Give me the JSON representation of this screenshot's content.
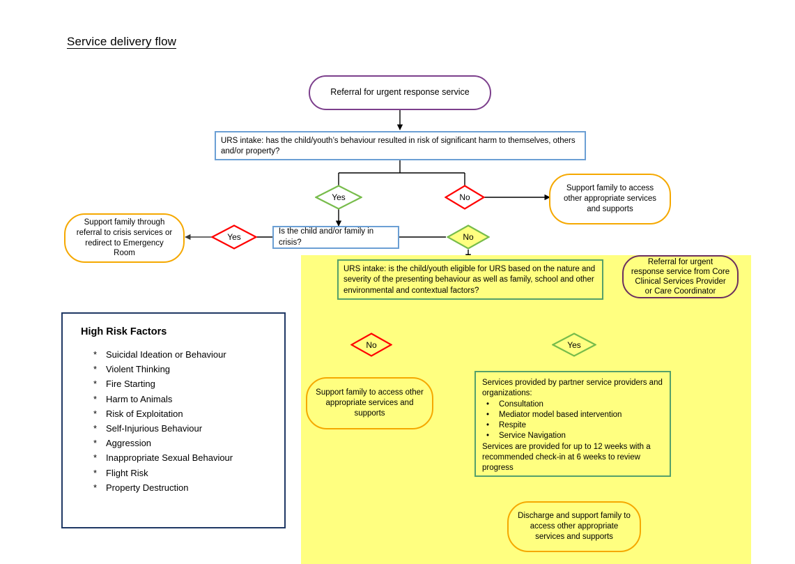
{
  "title": "Service delivery flow",
  "colors": {
    "highlight_region": "#ffff80",
    "terminator_border": "#7c3f8c",
    "orange_border": "#f5a800",
    "blue_border": "#6b9fd4",
    "green_border": "#55a06a",
    "yes_green": "#77bc4b",
    "no_red": "#ff0000",
    "legend_border": "#1f3864",
    "connector": "#000000"
  },
  "nodes": {
    "start": {
      "text": "Referral for urgent response service"
    },
    "intake_harm": {
      "text": "URS intake: has the child/youth’s behaviour resulted in risk of significant harm to themselves, others and/or property?"
    },
    "d1_yes": {
      "label": "Yes"
    },
    "d1_no": {
      "label": "No"
    },
    "support_other_1": {
      "text": "Support family to access other appropriate services and supports"
    },
    "crisis_question": {
      "text": "Is the child and/or family in crisis?"
    },
    "d2_yes": {
      "label": "Yes"
    },
    "d2_no": {
      "label": "No"
    },
    "crisis_referral": {
      "text": "Support family through referral to crisis services or redirect to Emergency Room"
    },
    "intake_eligible": {
      "text": "URS intake: is the child/youth eligible for URS based on the nature and severity of the presenting behaviour as well as family, school and other environmental and contextual factors?"
    },
    "core_clinical_referral": {
      "text": "Referral for urgent response service from Core Clinical Services Provider or Care Coordinator"
    },
    "d3_no": {
      "label": "No"
    },
    "d3_yes": {
      "label": "Yes"
    },
    "support_other_2": {
      "text": "Support family to access other appropriate services and supports"
    },
    "services": {
      "intro": "Services provided by partner service providers and organizations:",
      "bullet_char": "•",
      "items": [
        "Consultation",
        "Mediator model based intervention",
        "Respite",
        "Service Navigation"
      ],
      "footer": "Services are provided for up to 12 weeks with a recommended check-in at 6 weeks to review progress"
    },
    "discharge": {
      "text": "Discharge and support family to access other appropriate services and supports"
    }
  },
  "legend": {
    "heading": "High Risk Factors",
    "bullet_char": "*",
    "items": [
      "Suicidal Ideation or Behaviour",
      "Violent Thinking",
      "Fire Starting",
      "Harm to Animals",
      "Risk of Exploitation",
      "Self-Injurious Behaviour",
      "Aggression",
      "Inappropriate Sexual Behaviour",
      "Flight Risk",
      "Property Destruction"
    ]
  }
}
